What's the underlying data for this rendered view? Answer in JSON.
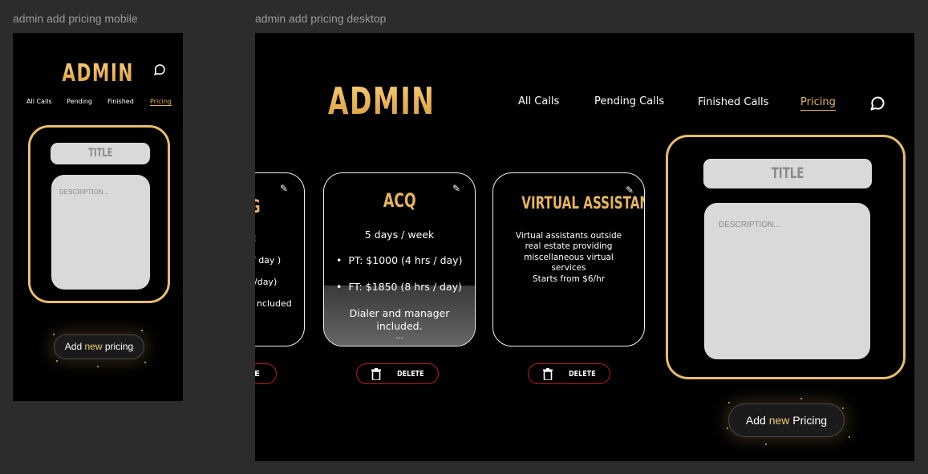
{
  "mobile": {
    "frame_label": "admin add pricing mobile",
    "brand": "ADMIN",
    "nav": [
      "All Calls",
      "Pending",
      "Finished",
      "Pricing"
    ],
    "title_placeholder": "TITLE",
    "description_placeholder": "DESCRIPTION...",
    "add_button": {
      "prefix": "Add ",
      "highlight": "new",
      "suffix": " pricing"
    }
  },
  "desktop": {
    "frame_label": "admin add pricing desktop",
    "brand": "ADMIN",
    "nav": [
      "All Calls",
      "Pending Calls",
      "Finished Calls",
      "Pricing"
    ],
    "cards": [
      {
        "title_fragment": "G",
        "lines": [
          ":",
          "/ day )",
          "/day)",
          "ncluded"
        ],
        "delete_label": "E"
      },
      {
        "title": "ACQ",
        "subtitle": "5 days / week",
        "bullets": [
          "PT: $1000 (4 hrs / day)",
          "FT: $1850 (8 hrs / day)"
        ],
        "footer": [
          "Dialer and manager",
          "included.",
          "..."
        ],
        "delete_label": "DELETE"
      },
      {
        "title": "VIRTUAL ASSISTANCE",
        "description": [
          "Virtual assistants outside",
          "real estate providing",
          "miscellaneous virtual",
          "services",
          "Starts from $6/hr"
        ],
        "delete_label": "DELETE"
      }
    ],
    "title_placeholder": "TITLE",
    "description_placeholder": "DESCRIPTION...",
    "add_button": {
      "prefix": "Add ",
      "highlight": "new",
      "suffix": " Pricing"
    }
  },
  "colors": {
    "accent": "#e6b45c",
    "delete_border": "#b5191f",
    "field_bg": "#d9d9d9"
  }
}
